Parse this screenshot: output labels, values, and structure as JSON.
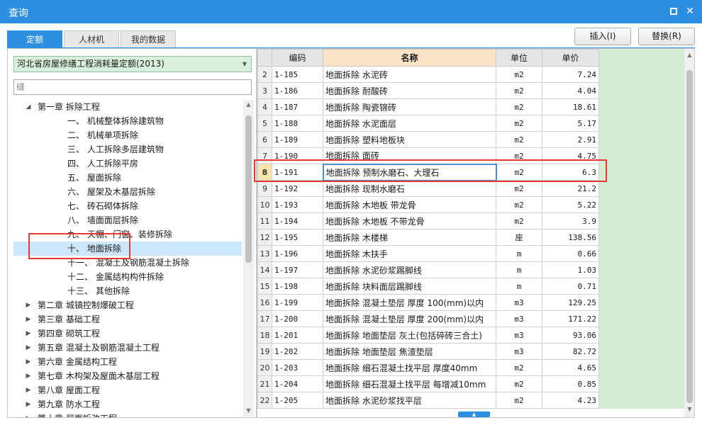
{
  "window": {
    "title": "查询",
    "maximize_icon": "maximize-icon",
    "close_icon": "close-icon",
    "close_glyph": "✕"
  },
  "tabs": [
    {
      "label": "定额",
      "active": true
    },
    {
      "label": "人材机",
      "active": false
    },
    {
      "label": "我的数据",
      "active": false
    }
  ],
  "actions": {
    "insert_label": "插入(I)",
    "replace_label": "替换(R)"
  },
  "left": {
    "quota_select": "河北省房屋修缮工程消耗量定额(2013)",
    "search_placeholder": "缝",
    "tree": [
      {
        "label": "第一章 拆除工程",
        "expanded": true,
        "level": 0
      },
      {
        "label": "一、 机械整体拆除建筑物",
        "level": 1
      },
      {
        "label": "二、 机械单项拆除",
        "level": 1
      },
      {
        "label": "三、 人工拆除多层建筑物",
        "level": 1
      },
      {
        "label": "四、 人工拆除平房",
        "level": 1
      },
      {
        "label": "五、 屋面拆除",
        "level": 1
      },
      {
        "label": "六、 屋架及木基层拆除",
        "level": 1
      },
      {
        "label": "七、 砖石砌体拆除",
        "level": 1
      },
      {
        "label": "八、 墙面面层拆除",
        "level": 1
      },
      {
        "label": "九、 天棚、门窗、装修拆除",
        "level": 1
      },
      {
        "label": "十、 地面拆除",
        "level": 1,
        "selected": true
      },
      {
        "label": "十一、 混凝土及钢筋混凝土拆除",
        "level": 1
      },
      {
        "label": "十二、 金属结构构件拆除",
        "level": 1
      },
      {
        "label": "十三、 其他拆除",
        "level": 1
      },
      {
        "label": "第二章 城镇控制爆破工程",
        "expanded": false,
        "level": 0
      },
      {
        "label": "第三章 基础工程",
        "expanded": false,
        "level": 0
      },
      {
        "label": "第四章 砌筑工程",
        "expanded": false,
        "level": 0
      },
      {
        "label": "第五章 混凝土及钢筋混凝土工程",
        "expanded": false,
        "level": 0
      },
      {
        "label": "第六章 金属结构工程",
        "expanded": false,
        "level": 0
      },
      {
        "label": "第七章 木构架及屋面木基层工程",
        "expanded": false,
        "level": 0
      },
      {
        "label": "第八章 屋面工程",
        "expanded": false,
        "level": 0
      },
      {
        "label": "第九章 防水工程",
        "expanded": false,
        "level": 0
      },
      {
        "label": "第十章 屋面拆改工程",
        "expanded": false,
        "level": 0
      }
    ]
  },
  "table": {
    "headers": {
      "row": "",
      "code": "编码",
      "name": "名称",
      "unit": "单位",
      "price": "单价"
    },
    "current_row": "8",
    "rows": [
      {
        "no": "2",
        "code": "1-185",
        "name": "地面拆除 水泥砖",
        "unit": "m2",
        "price": "7.24"
      },
      {
        "no": "3",
        "code": "1-186",
        "name": "地面拆除 耐酸砖",
        "unit": "m2",
        "price": "4.04"
      },
      {
        "no": "4",
        "code": "1-187",
        "name": "地面拆除 陶瓷锦砖",
        "unit": "m2",
        "price": "18.61"
      },
      {
        "no": "5",
        "code": "1-188",
        "name": "地面拆除 水泥面层",
        "unit": "m2",
        "price": "5.17"
      },
      {
        "no": "6",
        "code": "1-189",
        "name": "地面拆除 塑料地板块",
        "unit": "m2",
        "price": "2.91"
      },
      {
        "no": "7",
        "code": "1-190",
        "name": "地面拆除 面砖",
        "unit": "m2",
        "price": "4.75"
      },
      {
        "no": "8",
        "code": "1-191",
        "name": "地面拆除 预制水磨石、大理石",
        "unit": "m2",
        "price": "6.3"
      },
      {
        "no": "9",
        "code": "1-192",
        "name": "地面拆除 现制水磨石",
        "unit": "m2",
        "price": "21.2"
      },
      {
        "no": "10",
        "code": "1-193",
        "name": "地面拆除 木地板 带龙骨",
        "unit": "m2",
        "price": "5.22"
      },
      {
        "no": "11",
        "code": "1-194",
        "name": "地面拆除 木地板 不带龙骨",
        "unit": "m2",
        "price": "3.9"
      },
      {
        "no": "12",
        "code": "1-195",
        "name": "地面拆除 木楼梯",
        "unit": "座",
        "price": "138.56"
      },
      {
        "no": "13",
        "code": "1-196",
        "name": "地面拆除 木扶手",
        "unit": "m",
        "price": "0.66"
      },
      {
        "no": "14",
        "code": "1-197",
        "name": "地面拆除 水泥砂浆踢脚线",
        "unit": "m",
        "price": "1.03"
      },
      {
        "no": "15",
        "code": "1-198",
        "name": "地面拆除 块料面层踢脚线",
        "unit": "m",
        "price": "0.71"
      },
      {
        "no": "16",
        "code": "1-199",
        "name": "地面拆除 混凝土垫层 厚度 100(mm)以内",
        "unit": "m3",
        "price": "129.25"
      },
      {
        "no": "17",
        "code": "1-200",
        "name": "地面拆除 混凝土垫层 厚度 200(mm)以内",
        "unit": "m3",
        "price": "171.22"
      },
      {
        "no": "18",
        "code": "1-201",
        "name": "地面拆除 地面垫层 灰土(包括碎砖三合土)",
        "unit": "m3",
        "price": "93.06"
      },
      {
        "no": "19",
        "code": "1-202",
        "name": "地面拆除 地面垫层 焦渣垫层",
        "unit": "m3",
        "price": "82.72"
      },
      {
        "no": "20",
        "code": "1-203",
        "name": "地面拆除 细石混凝土找平层 厚度40mm",
        "unit": "m2",
        "price": "4.65"
      },
      {
        "no": "21",
        "code": "1-204",
        "name": "地面拆除 细石混凝土找平层 每增减10mm",
        "unit": "m2",
        "price": "0.85"
      },
      {
        "no": "22",
        "code": "1-205",
        "name": "地面拆除 水泥砂浆找平层",
        "unit": "m2",
        "price": "4.23"
      }
    ]
  },
  "colors": {
    "accent": "#2d8fe0",
    "highlight": "#e53935",
    "select_bg": "#d8f0dc",
    "price_area": "#d4ecd4"
  }
}
